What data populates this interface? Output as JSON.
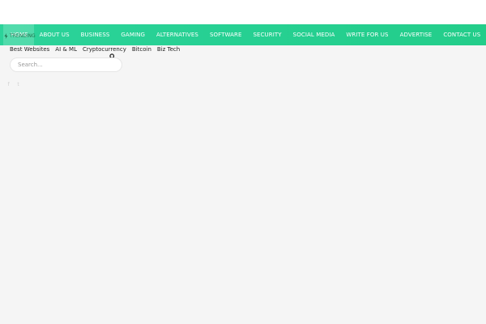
{
  "header": {
    "nav": [
      {
        "id": "home",
        "label": "HOME"
      },
      {
        "id": "about-us",
        "label": "ABOUT US"
      },
      {
        "id": "business",
        "label": "BUSINESS"
      },
      {
        "id": "gaming",
        "label": "GAMING"
      },
      {
        "id": "alternatives",
        "label": "ALTERNATIVES"
      },
      {
        "id": "software",
        "label": "SOFTWARE"
      },
      {
        "id": "security",
        "label": "SECURITY"
      },
      {
        "id": "social-media",
        "label": "SOCIAL MEDIA"
      },
      {
        "id": "write-for-us",
        "label": "WRITE FOR US"
      },
      {
        "id": "advertise",
        "label": "ADVERTISE"
      },
      {
        "id": "contact-us",
        "label": "CONTACT US"
      }
    ],
    "trending_label": "TRENDING",
    "accent_color": "#26d092"
  },
  "categories": [
    "Best Websites",
    "AI & ML",
    "Cryptocurrency",
    "Bitcoin",
    "Biz Tech"
  ],
  "search": {
    "placeholder": "Search..."
  },
  "social": {
    "icons": [
      "facebook-icon",
      "twitter-icon"
    ],
    "glyphs": [
      "f",
      "t"
    ]
  }
}
